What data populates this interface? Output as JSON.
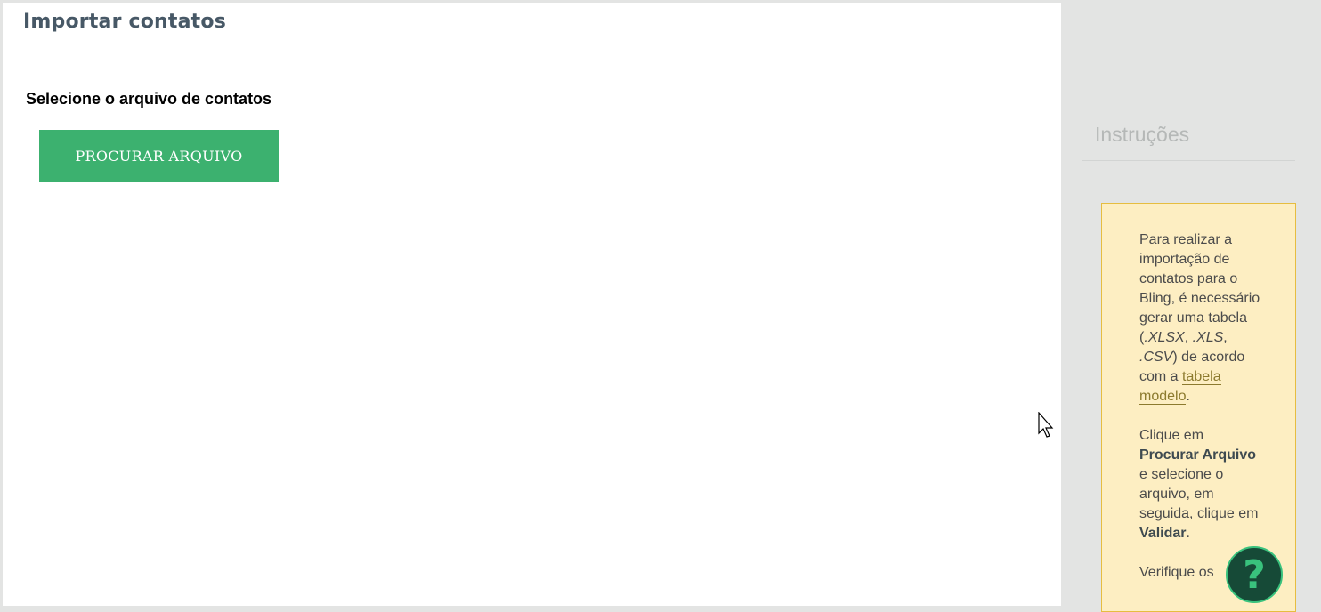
{
  "header": {
    "title": "Importar contatos"
  },
  "upload": {
    "label": "Selecione o arquivo de contatos",
    "button_label": "PROCURAR ARQUIVO"
  },
  "sidebar": {
    "title": "Instruções",
    "note": {
      "p1_a": "Para realizar a importação de contatos para o Bling, é necessário gerar uma tabela (",
      "p1_ext1": ".XLSX",
      "p1_sep1": ", ",
      "p1_ext2": ".XLS",
      "p1_sep2": ", ",
      "p1_ext3": ".CSV",
      "p1_b": ") de acordo com a ",
      "p1_link": "tabela modelo",
      "p1_end": ".",
      "p2_a": "Clique em ",
      "p2_bold1": "Procurar Arquivo",
      "p2_b": " e selecione o arquivo, em seguida, clique em ",
      "p2_bold2": "Validar",
      "p2_end": ".",
      "p3_a": "Verifique os"
    }
  },
  "help": {
    "icon_glyph": "?"
  },
  "colors": {
    "accent_green": "#3cb16f",
    "note_bg": "#fdeec2",
    "note_border": "#e6bd40",
    "help_bg": "#164a37"
  }
}
